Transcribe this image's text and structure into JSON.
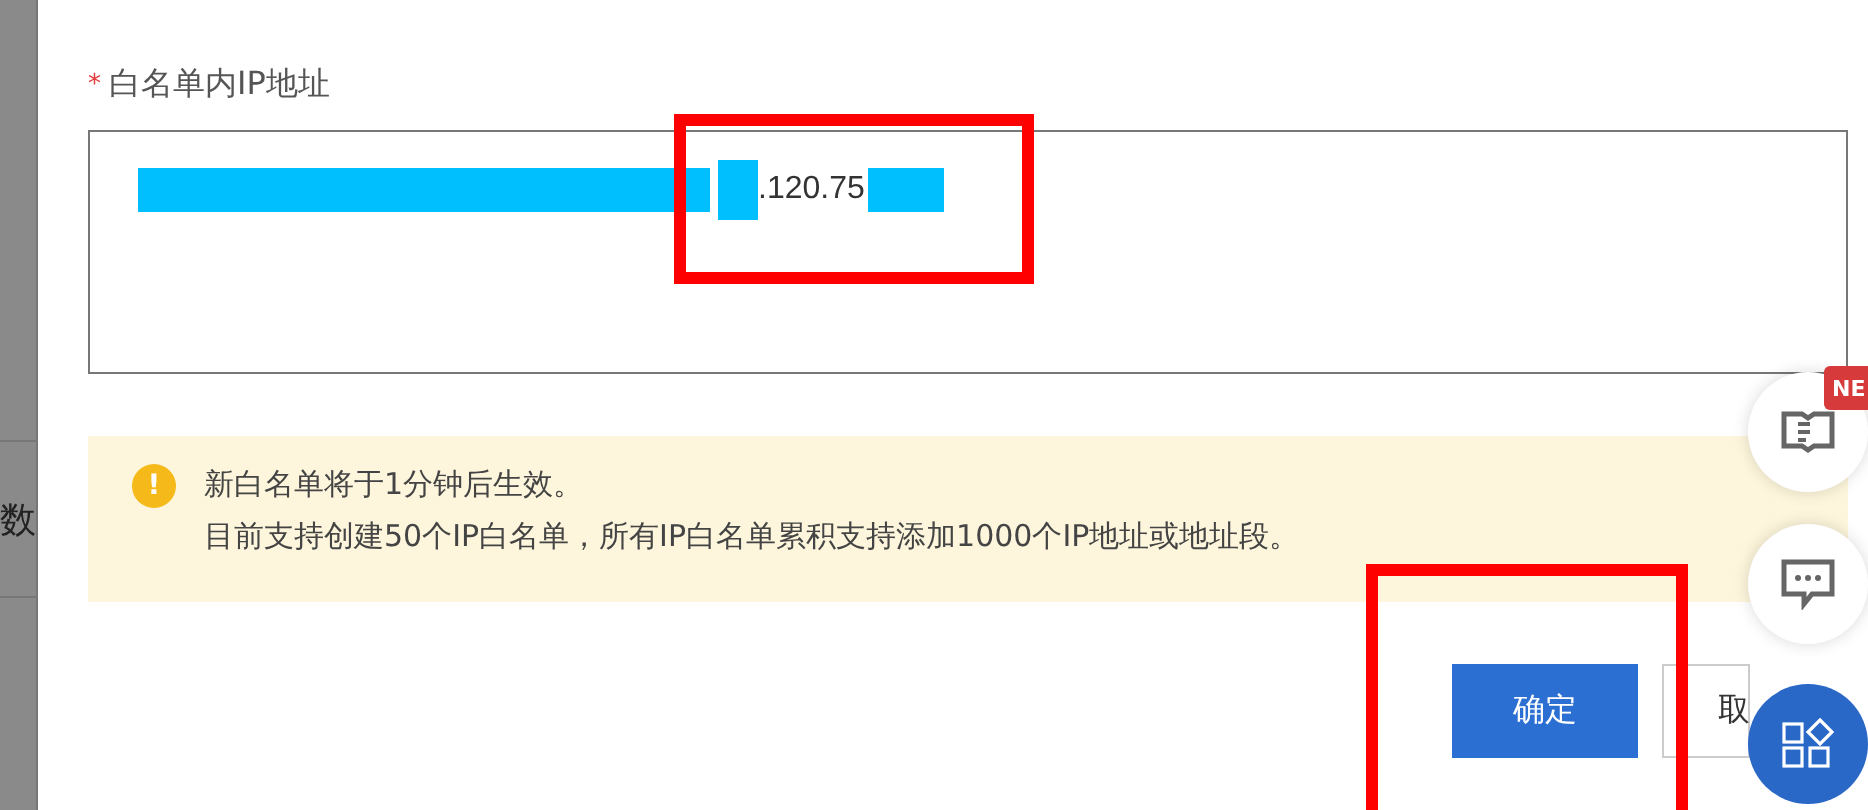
{
  "background_page": {
    "text": "数"
  },
  "form": {
    "required_mark": "*",
    "label": "白名单内IP地址",
    "ip_input": {
      "value": ".120.75"
    }
  },
  "notice": {
    "icon": "!",
    "lines": [
      "新白名单将于1分钟后生效。",
      "目前支持创建50个IP白名单，所有IP白名单累积支持添加1000个IP地址或地址段。"
    ]
  },
  "buttons": [
    {
      "label": "确定",
      "kind": "primary"
    },
    {
      "label": "取",
      "kind": "secondary"
    }
  ],
  "floating": {
    "badge": "NE"
  }
}
